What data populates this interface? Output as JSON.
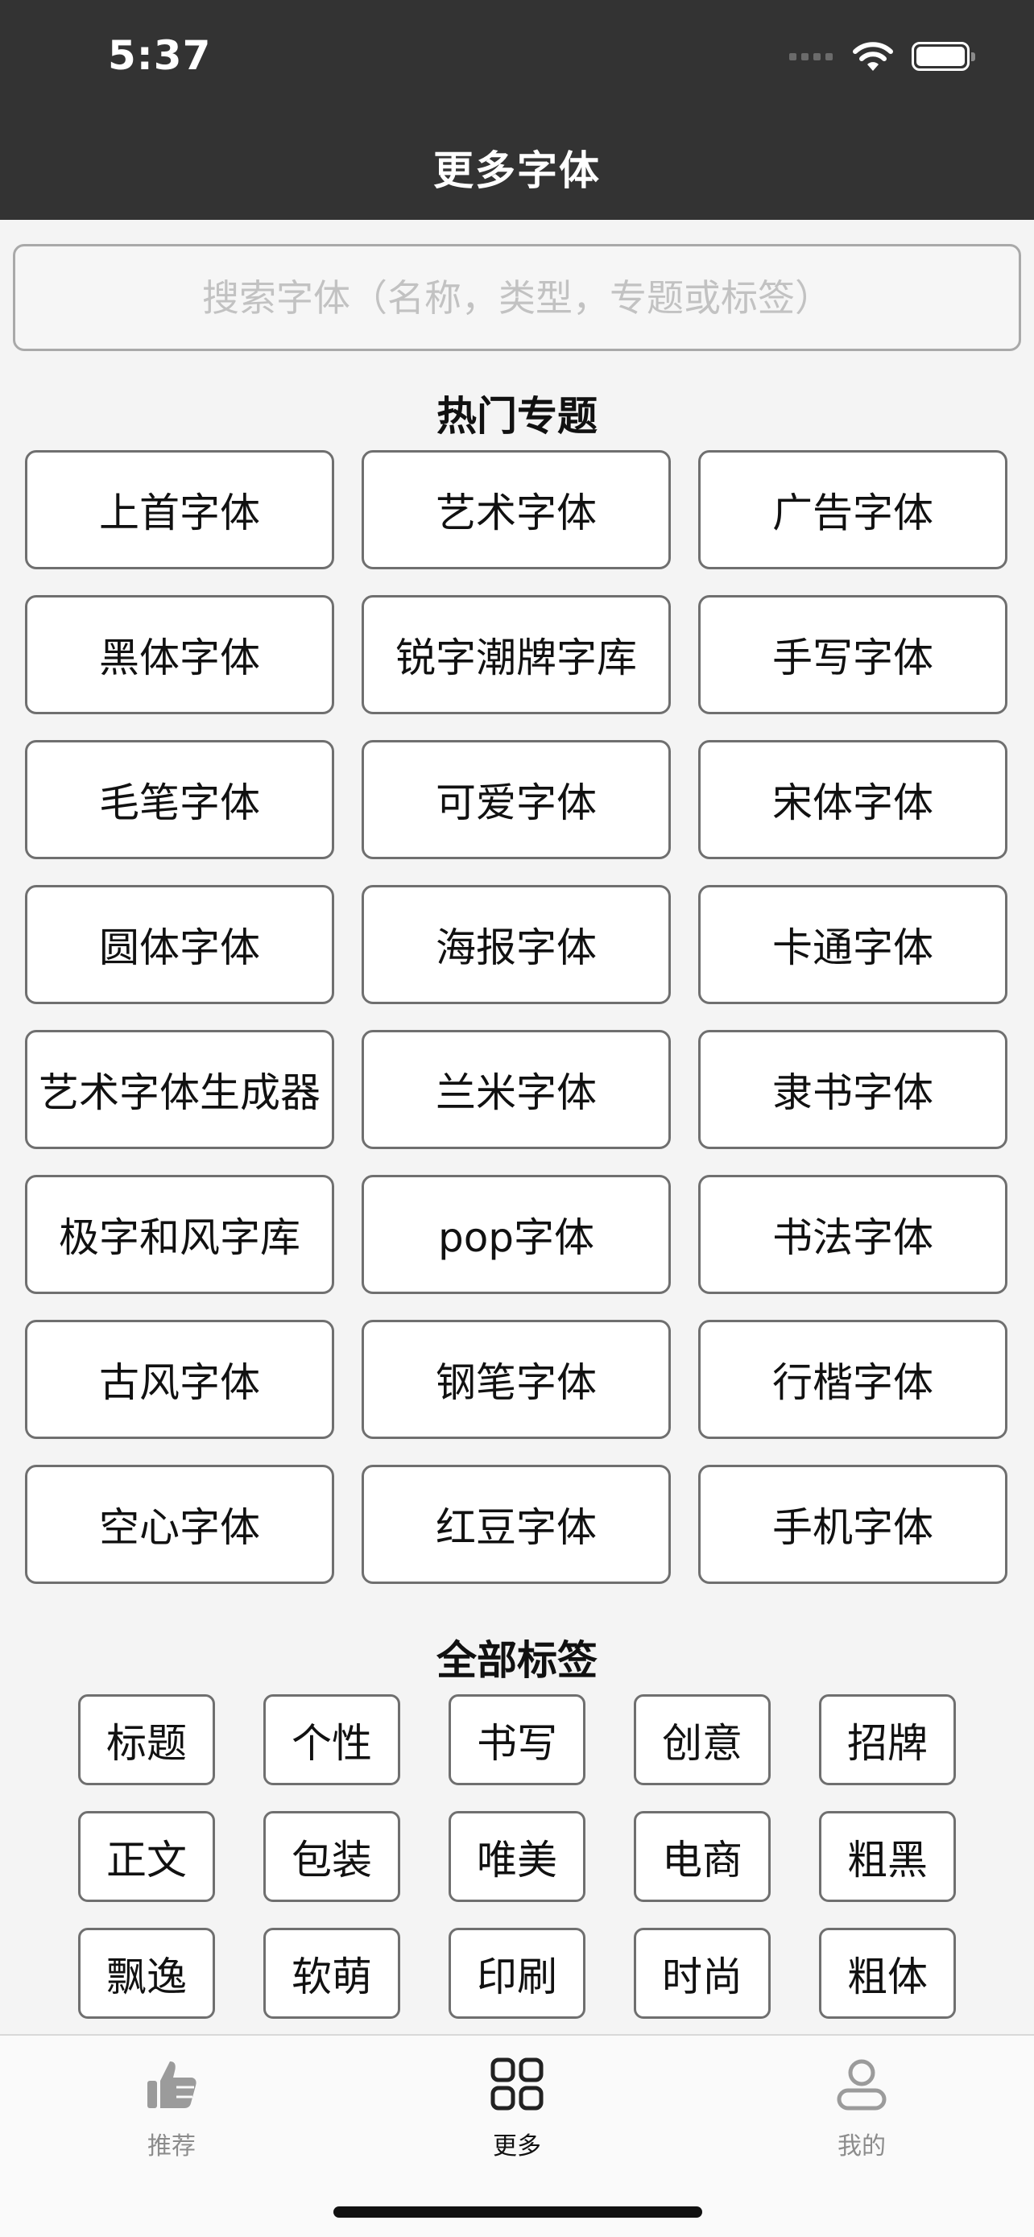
{
  "status_bar": {
    "time": "5:37"
  },
  "header": {
    "title": "更多字体"
  },
  "search": {
    "placeholder": "搜索字体（名称，类型，专题或标签）"
  },
  "hot_topics": {
    "title": "热门专题",
    "items": [
      "上首字体",
      "艺术字体",
      "广告字体",
      "黑体字体",
      "锐字潮牌字库",
      "手写字体",
      "毛笔字体",
      "可爱字体",
      "宋体字体",
      "圆体字体",
      "海报字体",
      "卡通字体",
      "艺术字体生成器",
      "兰米字体",
      "隶书字体",
      "极字和风字库",
      "pop字体",
      "书法字体",
      "古风字体",
      "钢笔字体",
      "行楷字体",
      "空心字体",
      "红豆字体",
      "手机字体"
    ]
  },
  "all_tags": {
    "title": "全部标签",
    "items": [
      "标题",
      "个性",
      "书写",
      "创意",
      "招牌",
      "正文",
      "包装",
      "唯美",
      "电商",
      "粗黑",
      "飘逸",
      "软萌",
      "印刷",
      "时尚",
      "粗体"
    ]
  },
  "tabbar": {
    "tabs": [
      {
        "label": "推荐",
        "icon": "thumbs-up-icon",
        "active": false
      },
      {
        "label": "更多",
        "icon": "grid-icon",
        "active": true
      },
      {
        "label": "我的",
        "icon": "user-icon",
        "active": false
      }
    ]
  },
  "colors": {
    "header_bg": "#333333",
    "page_bg": "#f4f4f4",
    "button_border": "#6f6f6f",
    "placeholder": "#c2c2c2",
    "tab_inactive": "#8c8c8c",
    "tab_active": "#111111"
  }
}
